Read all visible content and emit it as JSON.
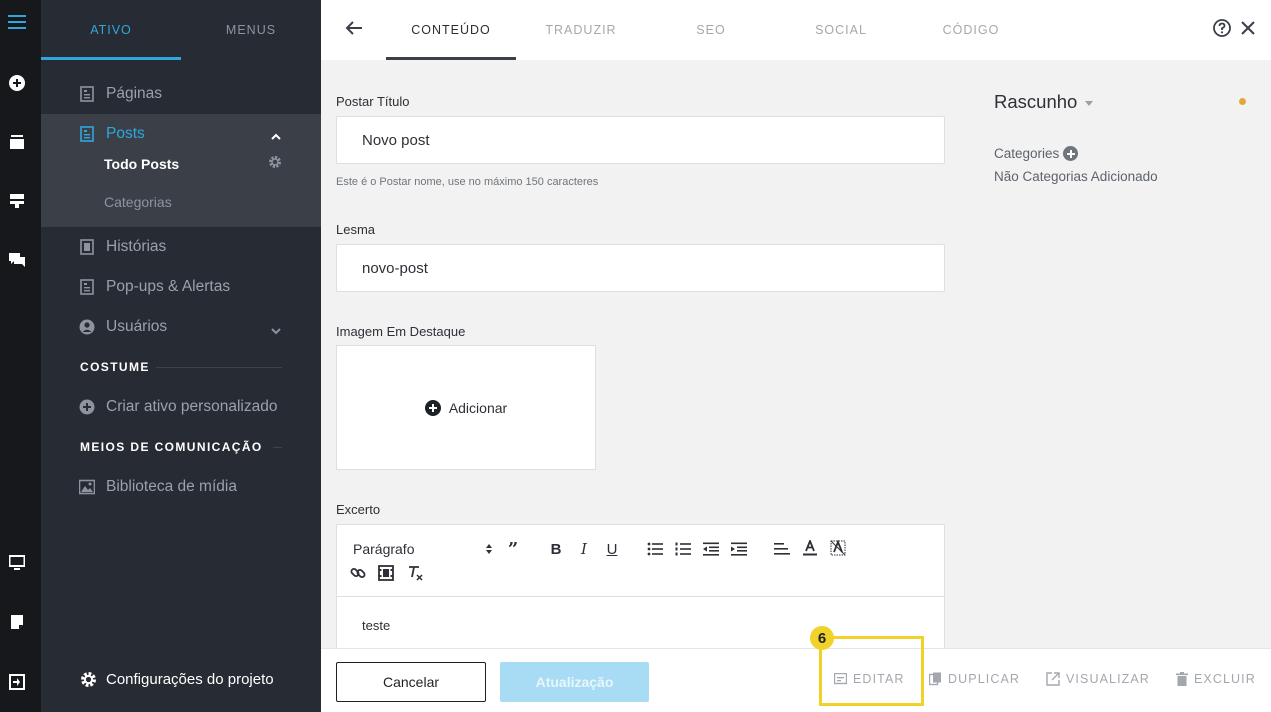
{
  "sidebar": {
    "tabs": [
      {
        "label": "ATIVO",
        "active": true
      },
      {
        "label": "MENUS",
        "active": false
      }
    ],
    "items": {
      "paginas": "Páginas",
      "posts": "Posts",
      "todo_posts": "Todo Posts",
      "categorias": "Categorias",
      "historias": "Histórias",
      "popups": "Pop-ups & Alertas",
      "usuarios": "Usuários"
    },
    "section_custom": "COSTUME",
    "criar_ativo": "Criar ativo personalizado",
    "section_media": "MEIOS DE COMUNICAÇÃO",
    "biblioteca": "Biblioteca de mídia",
    "project_settings": "Configurações do projeto"
  },
  "topbar": {
    "tabs": [
      {
        "label": "CONTEÚDO",
        "active": true
      },
      {
        "label": "TRADUZIR",
        "active": false
      },
      {
        "label": "SEO",
        "active": false
      },
      {
        "label": "SOCIAL",
        "active": false
      },
      {
        "label": "CÓDIGO",
        "active": false
      }
    ]
  },
  "form": {
    "title_label": "Postar Título",
    "title_value": "Novo post",
    "title_hint": "Este é o Postar nome, use no máximo 150 caracteres",
    "slug_label": "Lesma",
    "slug_value": "novo-post",
    "image_label": "Imagem Em Destaque",
    "image_add": "Adicionar",
    "excerpt_label": "Excerto",
    "paragraph_select": "Parágrafo",
    "excerpt_content": "teste"
  },
  "side_panel": {
    "status": "Rascunho",
    "status_color": "#e7a63a",
    "categories_label": "Categories",
    "categories_empty": "Não Categorias Adicionado"
  },
  "footer": {
    "cancel": "Cancelar",
    "update": "Atualização",
    "actions": {
      "edit": "EDITAR",
      "duplicate": "DUPLICAR",
      "preview": "VISUALIZAR",
      "delete": "EXCLUIR"
    }
  },
  "annotation": {
    "badge": "6",
    "color": "#f0d22b"
  }
}
